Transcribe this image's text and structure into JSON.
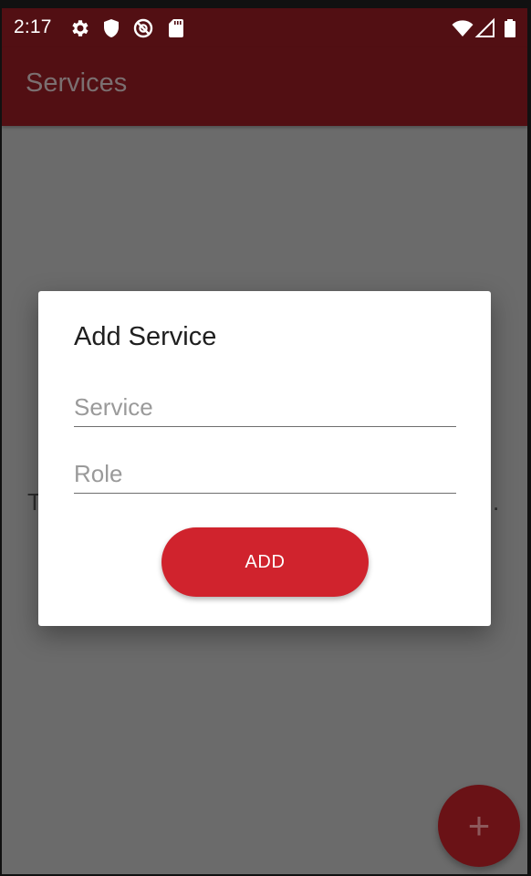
{
  "status_bar": {
    "time": "2:17",
    "icons": [
      "gear-icon",
      "shield-icon",
      "no-tracking-icon",
      "sd-card-icon",
      "wifi-icon",
      "signal-icon",
      "battery-icon"
    ]
  },
  "app_bar": {
    "title": "Services"
  },
  "background": {
    "partial_text_left": "T",
    "partial_text_right": "."
  },
  "dialog": {
    "title": "Add Service",
    "service_field": {
      "placeholder": "Service",
      "value": ""
    },
    "role_field": {
      "placeholder": "Role",
      "value": ""
    },
    "add_button_label": "ADD"
  },
  "fab": {
    "icon": "plus-icon",
    "symbol": "+"
  },
  "colors": {
    "primary_dark": "#520f13",
    "accent": "#d0232d",
    "scrim": "#6b6b6b"
  }
}
